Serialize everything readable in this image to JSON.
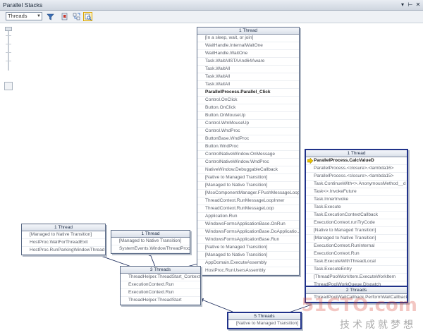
{
  "window": {
    "title": "Parallel Stacks"
  },
  "toolbar": {
    "view_select": "Threads",
    "buttons": [
      "filter-icon",
      "flag-icon",
      "toggle-method-view-icon",
      "auto-scroll-icon"
    ]
  },
  "colors": {
    "edge": "#1a2a5a",
    "node_border": "#5a6a86",
    "highlight_border": "#20328a",
    "current_arrow": "#e8c200"
  },
  "nodes": {
    "n1": {
      "header": "1 Thread",
      "frames": [
        "[In a sleep, wait, or join]",
        "WaitHandle.InternalWaitOne",
        "WaitHandle.WaitOne",
        "Task.WaitAllSTAAnd64Aware",
        "Task.WaitAll",
        "Task.WaitAll",
        "Task.WaitAll",
        "ParallelProcess.Parallel_Click",
        "Control.OnClick",
        "Button.OnClick",
        "Button.OnMouseUp",
        "Control.WmMouseUp",
        "Control.WndProc",
        "ButtonBase.WndProc",
        "Button.WndProc",
        "ControlNativeWindow.OnMessage",
        "ControlNativeWindow.WndProc",
        "NativeWindow.DebuggableCallback",
        "[Native to Managed Transition]",
        "[Managed to Native Transition]",
        "[MsoComponentManager.FPushMessageLoop",
        "ThreadContext.RunMessageLoopInner",
        "ThreadContext.RunMessageLoop",
        "Application.Run",
        "WindowsFormsApplicationBase.OnRun",
        "WindowsFormsApplicationBase.DoApplicatio...",
        "WindowsFormsApplicationBase.Run",
        "[Native to Managed Transition]",
        "[Managed to Native Transition]",
        "AppDomain.ExecuteAssembly",
        "HostProc.RunUsersAssembly"
      ]
    },
    "n2": {
      "header": "1 Thread",
      "frames": [
        "ParallelProcess.CalcValueD",
        "ParallelProcess.<closure>.<lambda16>",
        "ParallelProcess.<closure>.<lambda15>",
        "Task.ContinueWith<>.AnonymousMethod__d",
        "Task<>.InvokeFuture",
        "Task.InnerInvoke",
        "Task.Execute",
        "Task.ExecutionContextCallback",
        "ExecutionContext.runTryCode",
        "[Native to Managed Transition]",
        "[Managed to Native Transition]",
        "ExecutionContext.RunInternal",
        "ExecutionContext.Run",
        "Task.ExecuteWithThreadLocal",
        "Task.ExecuteEntry",
        "[ThreadPoolWorkItem.ExecuteWorkItem",
        "ThreadPoolWorkQueue.Dispatch"
      ]
    },
    "n3": {
      "header": "1 Thread",
      "frames": [
        "[Managed to Native Transition]",
        "HostProc.WaitForThreadExit",
        "HostProc.RunParkingWindowThread"
      ]
    },
    "n4": {
      "header": "1 Thread",
      "frames": [
        "[Managed to Native Transition]",
        "SystemEvents.WindowThreadProc"
      ]
    },
    "n5": {
      "header": "3 Threads",
      "frames": [
        "ThreadHelper.ThreadStart_Context",
        "ExecutionContext.Run",
        "ExecutionContext.Run",
        "ThreadHelper.ThreadStart"
      ]
    },
    "n6": {
      "header": "2 Threads",
      "frames": [
        "ThreadPoolWaitCallback.PerformWaitCallback"
      ]
    },
    "n7": {
      "header": "5 Threads",
      "frames": [
        "[Native to Managed Transition]"
      ]
    }
  },
  "watermark": {
    "logo": "51CTO.com",
    "slogan": "技术成就梦想"
  }
}
